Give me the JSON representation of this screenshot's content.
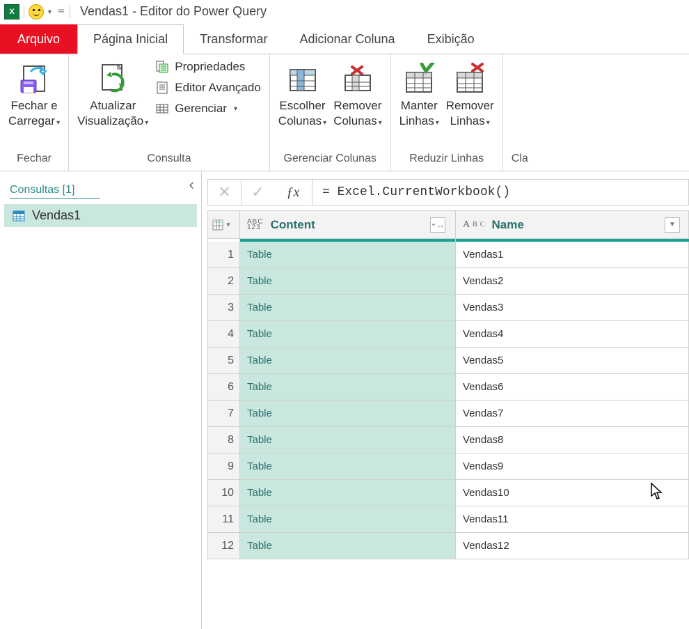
{
  "title": "Vendas1 - Editor do Power Query",
  "qat": {
    "excel_char": "X"
  },
  "tabs": {
    "arquivo": "Arquivo",
    "pagina": "Página Inicial",
    "transformar": "Transformar",
    "adicionar": "Adicionar Coluna",
    "exibicao": "Exibição"
  },
  "ribbon": {
    "fechar": {
      "close_load_l1": "Fechar e",
      "close_load_l2": "Carregar",
      "group_label": "Fechar"
    },
    "consulta": {
      "refresh_l1": "Atualizar",
      "refresh_l2": "Visualização",
      "props": "Propriedades",
      "adv": "Editor Avançado",
      "manage": "Gerenciar",
      "group_label": "Consulta"
    },
    "colunas": {
      "choose_l1": "Escolher",
      "choose_l2": "Colunas",
      "remove_l1": "Remover",
      "remove_l2": "Colunas",
      "group_label": "Gerenciar Colunas"
    },
    "linhas": {
      "keep_l1": "Manter",
      "keep_l2": "Linhas",
      "remove_l1": "Remover",
      "remove_l2": "Linhas",
      "group_label": "Reduzir Linhas"
    },
    "cla": "Cla"
  },
  "sidebar": {
    "title": "Consultas [1]",
    "item1": "Vendas1"
  },
  "formula": {
    "value": "= Excel.CurrentWorkbook()"
  },
  "table": {
    "col1": "Content",
    "col2": "Name",
    "type1": "ABC\n123",
    "rows": [
      {
        "i": "1",
        "c": "Table",
        "n": "Vendas1"
      },
      {
        "i": "2",
        "c": "Table",
        "n": "Vendas2"
      },
      {
        "i": "3",
        "c": "Table",
        "n": "Vendas3"
      },
      {
        "i": "4",
        "c": "Table",
        "n": "Vendas4"
      },
      {
        "i": "5",
        "c": "Table",
        "n": "Vendas5"
      },
      {
        "i": "6",
        "c": "Table",
        "n": "Vendas6"
      },
      {
        "i": "7",
        "c": "Table",
        "n": "Vendas7"
      },
      {
        "i": "8",
        "c": "Table",
        "n": "Vendas8"
      },
      {
        "i": "9",
        "c": "Table",
        "n": "Vendas9"
      },
      {
        "i": "10",
        "c": "Table",
        "n": "Vendas10"
      },
      {
        "i": "11",
        "c": "Table",
        "n": "Vendas11"
      },
      {
        "i": "12",
        "c": "Table",
        "n": "Vendas12"
      }
    ]
  }
}
